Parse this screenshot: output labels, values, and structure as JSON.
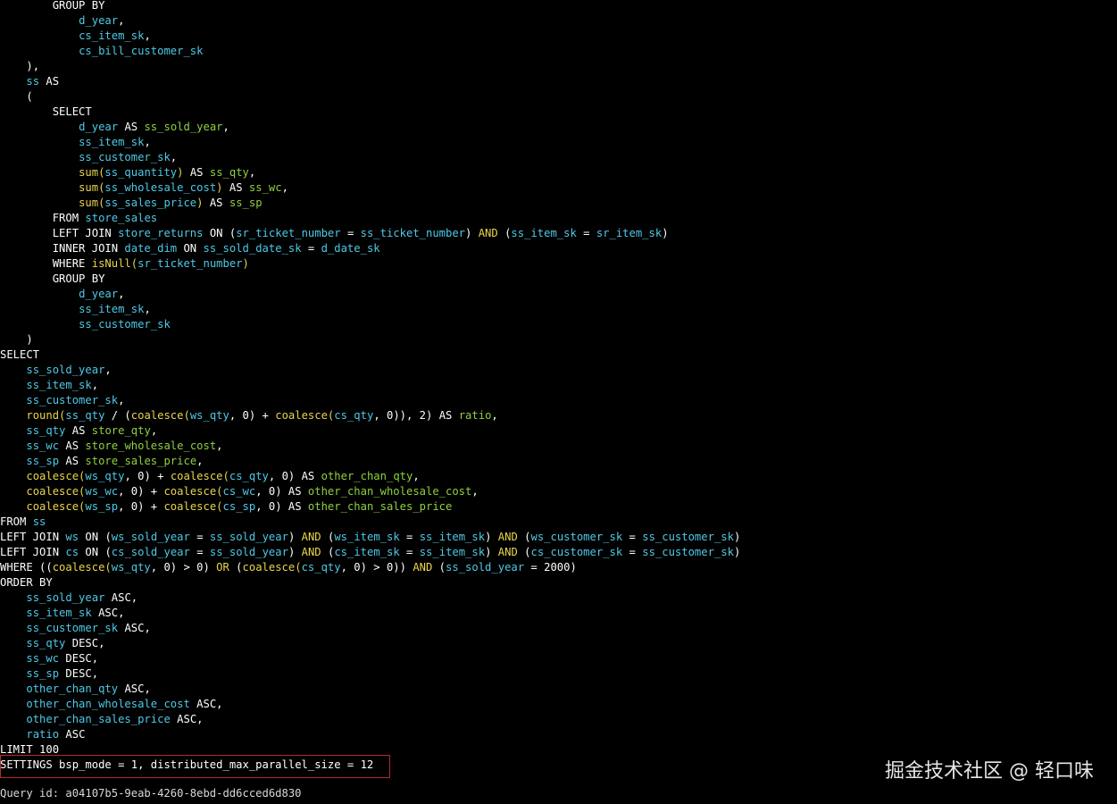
{
  "colors": {
    "background": "#000000",
    "keyword": "#ffffff",
    "identifier": "#4ec9e6",
    "alias": "#8fd13e",
    "function": "#e8d54a",
    "highlight_box": "#b52a2a"
  },
  "code_lines": [
    {
      "indent": 8,
      "tokens": [
        [
          "kw",
          "GROUP BY"
        ]
      ]
    },
    {
      "indent": 12,
      "tokens": [
        [
          "id",
          "d_year"
        ],
        [
          "pl",
          ","
        ]
      ]
    },
    {
      "indent": 12,
      "tokens": [
        [
          "id",
          "cs_item_sk"
        ],
        [
          "pl",
          ","
        ]
      ]
    },
    {
      "indent": 12,
      "tokens": [
        [
          "id",
          "cs_bill_customer_sk"
        ]
      ]
    },
    {
      "indent": 4,
      "tokens": [
        [
          "pl",
          "),"
        ]
      ]
    },
    {
      "indent": 4,
      "tokens": [
        [
          "id",
          "ss"
        ],
        [
          "pl",
          " "
        ],
        [
          "kw",
          "AS"
        ]
      ]
    },
    {
      "indent": 4,
      "tokens": [
        [
          "pl",
          "("
        ]
      ]
    },
    {
      "indent": 8,
      "tokens": [
        [
          "kw",
          "SELECT"
        ]
      ]
    },
    {
      "indent": 12,
      "tokens": [
        [
          "id",
          "d_year"
        ],
        [
          "pl",
          " "
        ],
        [
          "kw",
          "AS"
        ],
        [
          "pl",
          " "
        ],
        [
          "al",
          "ss_sold_year"
        ],
        [
          "pl",
          ","
        ]
      ]
    },
    {
      "indent": 12,
      "tokens": [
        [
          "id",
          "ss_item_sk"
        ],
        [
          "pl",
          ","
        ]
      ]
    },
    {
      "indent": 12,
      "tokens": [
        [
          "id",
          "ss_customer_sk"
        ],
        [
          "pl",
          ","
        ]
      ]
    },
    {
      "indent": 12,
      "tokens": [
        [
          "fn",
          "sum("
        ],
        [
          "id",
          "ss_quantity"
        ],
        [
          "fn",
          ")"
        ],
        [
          "pl",
          " "
        ],
        [
          "kw",
          "AS"
        ],
        [
          "pl",
          " "
        ],
        [
          "al",
          "ss_qty"
        ],
        [
          "pl",
          ","
        ]
      ]
    },
    {
      "indent": 12,
      "tokens": [
        [
          "fn",
          "sum("
        ],
        [
          "id",
          "ss_wholesale_cost"
        ],
        [
          "fn",
          ")"
        ],
        [
          "pl",
          " "
        ],
        [
          "kw",
          "AS"
        ],
        [
          "pl",
          " "
        ],
        [
          "al",
          "ss_wc"
        ],
        [
          "pl",
          ","
        ]
      ]
    },
    {
      "indent": 12,
      "tokens": [
        [
          "fn",
          "sum("
        ],
        [
          "id",
          "ss_sales_price"
        ],
        [
          "fn",
          ")"
        ],
        [
          "pl",
          " "
        ],
        [
          "kw",
          "AS"
        ],
        [
          "pl",
          " "
        ],
        [
          "al",
          "ss_sp"
        ]
      ]
    },
    {
      "indent": 8,
      "tokens": [
        [
          "kw",
          "FROM"
        ],
        [
          "pl",
          " "
        ],
        [
          "id",
          "store_sales"
        ]
      ]
    },
    {
      "indent": 8,
      "tokens": [
        [
          "kw",
          "LEFT JOIN"
        ],
        [
          "pl",
          " "
        ],
        [
          "id",
          "store_returns"
        ],
        [
          "pl",
          " "
        ],
        [
          "kw",
          "ON"
        ],
        [
          "pl",
          " ("
        ],
        [
          "id",
          "sr_ticket_number"
        ],
        [
          "pl",
          " = "
        ],
        [
          "id",
          "ss_ticket_number"
        ],
        [
          "pl",
          ") "
        ],
        [
          "fn",
          "AND"
        ],
        [
          "pl",
          " ("
        ],
        [
          "id",
          "ss_item_sk"
        ],
        [
          "pl",
          " = "
        ],
        [
          "id",
          "sr_item_sk"
        ],
        [
          "pl",
          ")"
        ]
      ]
    },
    {
      "indent": 8,
      "tokens": [
        [
          "kw",
          "INNER JOIN"
        ],
        [
          "pl",
          " "
        ],
        [
          "id",
          "date_dim"
        ],
        [
          "pl",
          " "
        ],
        [
          "kw",
          "ON"
        ],
        [
          "pl",
          " "
        ],
        [
          "id",
          "ss_sold_date_sk"
        ],
        [
          "pl",
          " = "
        ],
        [
          "id",
          "d_date_sk"
        ]
      ]
    },
    {
      "indent": 8,
      "tokens": [
        [
          "kw",
          "WHERE"
        ],
        [
          "pl",
          " "
        ],
        [
          "fn",
          "isNull("
        ],
        [
          "id",
          "sr_ticket_number"
        ],
        [
          "fn",
          ")"
        ]
      ]
    },
    {
      "indent": 8,
      "tokens": [
        [
          "kw",
          "GROUP BY"
        ]
      ]
    },
    {
      "indent": 12,
      "tokens": [
        [
          "id",
          "d_year"
        ],
        [
          "pl",
          ","
        ]
      ]
    },
    {
      "indent": 12,
      "tokens": [
        [
          "id",
          "ss_item_sk"
        ],
        [
          "pl",
          ","
        ]
      ]
    },
    {
      "indent": 12,
      "tokens": [
        [
          "id",
          "ss_customer_sk"
        ]
      ]
    },
    {
      "indent": 4,
      "tokens": [
        [
          "pl",
          ")"
        ]
      ]
    },
    {
      "indent": 0,
      "tokens": [
        [
          "kw",
          "SELECT"
        ]
      ]
    },
    {
      "indent": 4,
      "tokens": [
        [
          "id",
          "ss_sold_year"
        ],
        [
          "pl",
          ","
        ]
      ]
    },
    {
      "indent": 4,
      "tokens": [
        [
          "id",
          "ss_item_sk"
        ],
        [
          "pl",
          ","
        ]
      ]
    },
    {
      "indent": 4,
      "tokens": [
        [
          "id",
          "ss_customer_sk"
        ],
        [
          "pl",
          ","
        ]
      ]
    },
    {
      "indent": 4,
      "tokens": [
        [
          "fn",
          "round("
        ],
        [
          "id",
          "ss_qty"
        ],
        [
          "pl",
          " / ("
        ],
        [
          "fn",
          "coalesce("
        ],
        [
          "id",
          "ws_qty"
        ],
        [
          "pl",
          ", 0) + "
        ],
        [
          "fn",
          "coalesce("
        ],
        [
          "id",
          "cs_qty"
        ],
        [
          "pl",
          ", 0)), 2) "
        ],
        [
          "kw",
          "AS"
        ],
        [
          "pl",
          " "
        ],
        [
          "al",
          "ratio"
        ],
        [
          "pl",
          ","
        ]
      ]
    },
    {
      "indent": 4,
      "tokens": [
        [
          "id",
          "ss_qty"
        ],
        [
          "pl",
          " "
        ],
        [
          "kw",
          "AS"
        ],
        [
          "pl",
          " "
        ],
        [
          "al",
          "store_qty"
        ],
        [
          "pl",
          ","
        ]
      ]
    },
    {
      "indent": 4,
      "tokens": [
        [
          "id",
          "ss_wc"
        ],
        [
          "pl",
          " "
        ],
        [
          "kw",
          "AS"
        ],
        [
          "pl",
          " "
        ],
        [
          "al",
          "store_wholesale_cost"
        ],
        [
          "pl",
          ","
        ]
      ]
    },
    {
      "indent": 4,
      "tokens": [
        [
          "id",
          "ss_sp"
        ],
        [
          "pl",
          " "
        ],
        [
          "kw",
          "AS"
        ],
        [
          "pl",
          " "
        ],
        [
          "al",
          "store_sales_price"
        ],
        [
          "pl",
          ","
        ]
      ]
    },
    {
      "indent": 4,
      "tokens": [
        [
          "fn",
          "coalesce("
        ],
        [
          "id",
          "ws_qty"
        ],
        [
          "pl",
          ", 0) + "
        ],
        [
          "fn",
          "coalesce("
        ],
        [
          "id",
          "cs_qty"
        ],
        [
          "pl",
          ", 0) "
        ],
        [
          "kw",
          "AS"
        ],
        [
          "pl",
          " "
        ],
        [
          "al",
          "other_chan_qty"
        ],
        [
          "pl",
          ","
        ]
      ]
    },
    {
      "indent": 4,
      "tokens": [
        [
          "fn",
          "coalesce("
        ],
        [
          "id",
          "ws_wc"
        ],
        [
          "pl",
          ", 0) + "
        ],
        [
          "fn",
          "coalesce("
        ],
        [
          "id",
          "cs_wc"
        ],
        [
          "pl",
          ", 0) "
        ],
        [
          "kw",
          "AS"
        ],
        [
          "pl",
          " "
        ],
        [
          "al",
          "other_chan_wholesale_cost"
        ],
        [
          "pl",
          ","
        ]
      ]
    },
    {
      "indent": 4,
      "tokens": [
        [
          "fn",
          "coalesce("
        ],
        [
          "id",
          "ws_sp"
        ],
        [
          "pl",
          ", 0) + "
        ],
        [
          "fn",
          "coalesce("
        ],
        [
          "id",
          "cs_sp"
        ],
        [
          "pl",
          ", 0) "
        ],
        [
          "kw",
          "AS"
        ],
        [
          "pl",
          " "
        ],
        [
          "al",
          "other_chan_sales_price"
        ]
      ]
    },
    {
      "indent": 0,
      "tokens": [
        [
          "kw",
          "FROM"
        ],
        [
          "pl",
          " "
        ],
        [
          "id",
          "ss"
        ]
      ]
    },
    {
      "indent": 0,
      "tokens": [
        [
          "kw",
          "LEFT JOIN"
        ],
        [
          "pl",
          " "
        ],
        [
          "id",
          "ws"
        ],
        [
          "pl",
          " "
        ],
        [
          "kw",
          "ON"
        ],
        [
          "pl",
          " ("
        ],
        [
          "id",
          "ws_sold_year"
        ],
        [
          "pl",
          " = "
        ],
        [
          "id",
          "ss_sold_year"
        ],
        [
          "pl",
          ") "
        ],
        [
          "fn",
          "AND"
        ],
        [
          "pl",
          " ("
        ],
        [
          "id",
          "ws_item_sk"
        ],
        [
          "pl",
          " = "
        ],
        [
          "id",
          "ss_item_sk"
        ],
        [
          "pl",
          ") "
        ],
        [
          "fn",
          "AND"
        ],
        [
          "pl",
          " ("
        ],
        [
          "id",
          "ws_customer_sk"
        ],
        [
          "pl",
          " = "
        ],
        [
          "id",
          "ss_customer_sk"
        ],
        [
          "pl",
          ")"
        ]
      ]
    },
    {
      "indent": 0,
      "tokens": [
        [
          "kw",
          "LEFT JOIN"
        ],
        [
          "pl",
          " "
        ],
        [
          "id",
          "cs"
        ],
        [
          "pl",
          " "
        ],
        [
          "kw",
          "ON"
        ],
        [
          "pl",
          " ("
        ],
        [
          "id",
          "cs_sold_year"
        ],
        [
          "pl",
          " = "
        ],
        [
          "id",
          "ss_sold_year"
        ],
        [
          "pl",
          ") "
        ],
        [
          "fn",
          "AND"
        ],
        [
          "pl",
          " ("
        ],
        [
          "id",
          "cs_item_sk"
        ],
        [
          "pl",
          " = "
        ],
        [
          "id",
          "ss_item_sk"
        ],
        [
          "pl",
          ") "
        ],
        [
          "fn",
          "AND"
        ],
        [
          "pl",
          " ("
        ],
        [
          "id",
          "cs_customer_sk"
        ],
        [
          "pl",
          " = "
        ],
        [
          "id",
          "ss_customer_sk"
        ],
        [
          "pl",
          ")"
        ]
      ]
    },
    {
      "indent": 0,
      "tokens": [
        [
          "kw",
          "WHERE"
        ],
        [
          "pl",
          " (("
        ],
        [
          "fn",
          "coalesce("
        ],
        [
          "id",
          "ws_qty"
        ],
        [
          "pl",
          ", 0) > 0) "
        ],
        [
          "fn",
          "OR"
        ],
        [
          "pl",
          " ("
        ],
        [
          "fn",
          "coalesce("
        ],
        [
          "id",
          "cs_qty"
        ],
        [
          "pl",
          ", 0) > 0)) "
        ],
        [
          "fn",
          "AND"
        ],
        [
          "pl",
          " ("
        ],
        [
          "id",
          "ss_sold_year"
        ],
        [
          "pl",
          " = 2000)"
        ]
      ]
    },
    {
      "indent": 0,
      "tokens": [
        [
          "kw",
          "ORDER BY"
        ]
      ]
    },
    {
      "indent": 4,
      "tokens": [
        [
          "id",
          "ss_sold_year"
        ],
        [
          "pl",
          " "
        ],
        [
          "kw",
          "ASC"
        ],
        [
          "pl",
          ","
        ]
      ]
    },
    {
      "indent": 4,
      "tokens": [
        [
          "id",
          "ss_item_sk"
        ],
        [
          "pl",
          " "
        ],
        [
          "kw",
          "ASC"
        ],
        [
          "pl",
          ","
        ]
      ]
    },
    {
      "indent": 4,
      "tokens": [
        [
          "id",
          "ss_customer_sk"
        ],
        [
          "pl",
          " "
        ],
        [
          "kw",
          "ASC"
        ],
        [
          "pl",
          ","
        ]
      ]
    },
    {
      "indent": 4,
      "tokens": [
        [
          "id",
          "ss_qty"
        ],
        [
          "pl",
          " "
        ],
        [
          "kw",
          "DESC"
        ],
        [
          "pl",
          ","
        ]
      ]
    },
    {
      "indent": 4,
      "tokens": [
        [
          "id",
          "ss_wc"
        ],
        [
          "pl",
          " "
        ],
        [
          "kw",
          "DESC"
        ],
        [
          "pl",
          ","
        ]
      ]
    },
    {
      "indent": 4,
      "tokens": [
        [
          "id",
          "ss_sp"
        ],
        [
          "pl",
          " "
        ],
        [
          "kw",
          "DESC"
        ],
        [
          "pl",
          ","
        ]
      ]
    },
    {
      "indent": 4,
      "tokens": [
        [
          "id",
          "other_chan_qty"
        ],
        [
          "pl",
          " "
        ],
        [
          "kw",
          "ASC"
        ],
        [
          "pl",
          ","
        ]
      ]
    },
    {
      "indent": 4,
      "tokens": [
        [
          "id",
          "other_chan_wholesale_cost"
        ],
        [
          "pl",
          " "
        ],
        [
          "kw",
          "ASC"
        ],
        [
          "pl",
          ","
        ]
      ]
    },
    {
      "indent": 4,
      "tokens": [
        [
          "id",
          "other_chan_sales_price"
        ],
        [
          "pl",
          " "
        ],
        [
          "kw",
          "ASC"
        ],
        [
          "pl",
          ","
        ]
      ]
    },
    {
      "indent": 4,
      "tokens": [
        [
          "id",
          "ratio"
        ],
        [
          "pl",
          " "
        ],
        [
          "kw",
          "ASC"
        ]
      ]
    },
    {
      "indent": 0,
      "tokens": [
        [
          "kw",
          "LIMIT"
        ],
        [
          "pl",
          " 100"
        ]
      ]
    },
    {
      "indent": 0,
      "tokens": [
        [
          "kw",
          "SETTINGS"
        ],
        [
          "pl",
          " bsp_mode = 1, distributed_max_parallel_size = 12"
        ]
      ]
    }
  ],
  "query_id_line": "Query id: a04107b5-9eab-4260-8ebd-dd6cced6d830",
  "watermark": "掘金技术社区 @ 轻口味"
}
